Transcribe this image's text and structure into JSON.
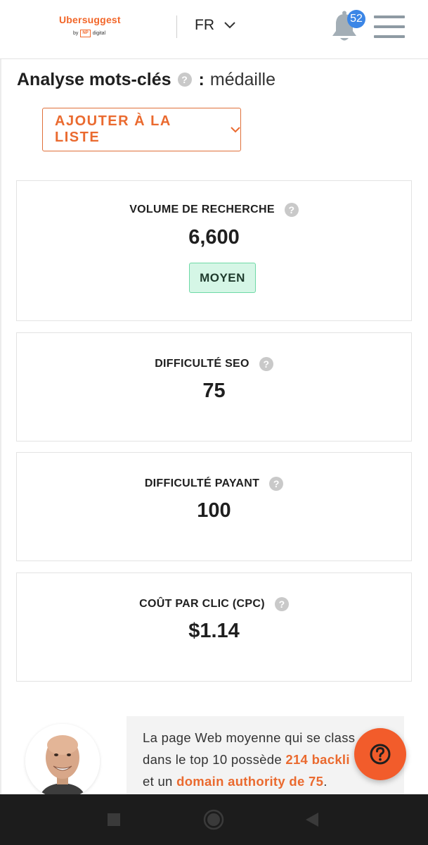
{
  "header": {
    "logo_name": "Ubersuggest",
    "logo_by": "by",
    "logo_np": "NP",
    "logo_digital": "digital",
    "language": "FR",
    "notification_count": "52"
  },
  "page": {
    "title": "Analyse mots-clés",
    "help_glyph": "?",
    "separator": ":",
    "keyword": "médaille"
  },
  "add_button": {
    "label": "AJOUTER À LA LISTE"
  },
  "metrics": [
    {
      "label": "VOLUME DE RECHERCHE",
      "value": "6,600",
      "level": "MOYEN"
    },
    {
      "label": "DIFFICULTÉ SEO",
      "value": "75"
    },
    {
      "label": "DIFFICULTÉ PAYANT",
      "value": "100"
    },
    {
      "label": "COÛT PAR CLIC (CPC)",
      "value": "$1.14"
    }
  ],
  "tip": {
    "part1": "La page Web moyenne qui se class",
    "part2": "dans le top 10 possède ",
    "highlight1": "214 backli",
    "part3": "et un ",
    "highlight2": "domain authority de 75",
    "part4": "."
  },
  "colors": {
    "accent": "#f2672a",
    "badge_blue": "#3b86e6",
    "level_bg": "#d5f6e6",
    "level_border": "#6ed9a6",
    "nav_bg": "#1c1c1c"
  },
  "icons": {
    "bell": "bell-icon",
    "menu": "hamburger-menu-icon",
    "help": "question-mark-icon",
    "chevron": "chevron-down-icon",
    "nav_recents": "square-icon",
    "nav_home": "circle-icon",
    "nav_back": "triangle-back-icon"
  }
}
